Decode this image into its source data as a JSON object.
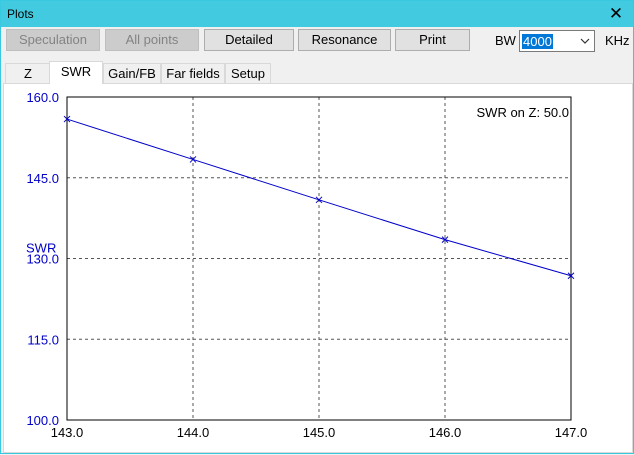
{
  "window": {
    "title": "Plots"
  },
  "toolbar": {
    "speculation_label": "Speculation",
    "all_points_label": "All points",
    "detailed_label": "Detailed",
    "resonance_label": "Resonance",
    "print_label": "Print",
    "bw_label": "BW",
    "bw_value": "4000",
    "khz_label": "KHz"
  },
  "tabs": [
    {
      "label": "Z"
    },
    {
      "label": "SWR"
    },
    {
      "label": "Gain/FB"
    },
    {
      "label": "Far fields"
    },
    {
      "label": "Setup"
    }
  ],
  "colors": {
    "axis_text": "#0000c8",
    "series": "#0000c8",
    "grid": "#555555"
  },
  "chart_data": {
    "type": "line",
    "title": "",
    "annotation": "SWR on Z: 50.0",
    "xlabel": "",
    "ylabel": "SWR",
    "xlim": [
      143.0,
      147.0
    ],
    "ylim": [
      100.0,
      160.0
    ],
    "x_ticks": [
      "143.0",
      "144.0",
      "145.0",
      "146.0",
      "147.0"
    ],
    "y_ticks": [
      "160.0",
      "145.0",
      "130.0",
      "115.0",
      "100.0"
    ],
    "grid": true,
    "series": [
      {
        "x": [
          143.0,
          144.0,
          145.0,
          146.0,
          147.0
        ],
        "y": [
          155.9,
          148.4,
          140.9,
          133.5,
          126.8
        ]
      }
    ]
  }
}
